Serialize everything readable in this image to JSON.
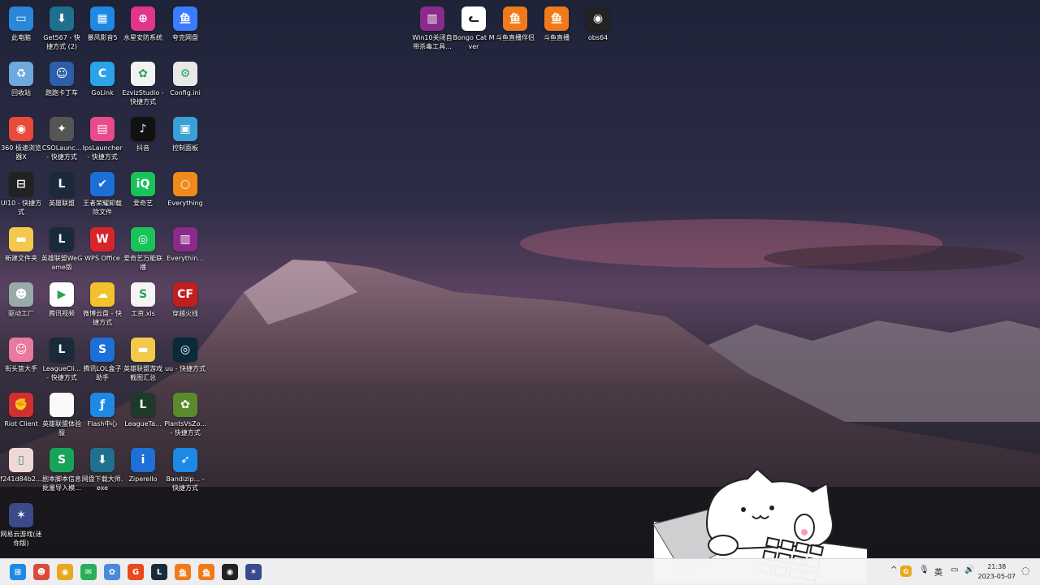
{
  "desktop": {
    "icons": [
      {
        "label": "此电脑",
        "icon": "computer-icon",
        "color": "#2b87d8",
        "glyph": "▭"
      },
      {
        "label": "Get567 - 快捷方式 (2)",
        "icon": "download-icon",
        "color": "#1f6f8f",
        "glyph": "⬇"
      },
      {
        "label": "暴风影音5",
        "icon": "grid-app-icon",
        "color": "#1e88e5",
        "glyph": "▦"
      },
      {
        "label": "水星安防系统",
        "icon": "target-icon",
        "color": "#e0358a",
        "glyph": "⊕"
      },
      {
        "label": "夸克网盘",
        "icon": "cloud-icon",
        "color": "#3a7bff",
        "glyph": "鱼"
      },
      {
        "label": "回收站",
        "icon": "recycle-bin-icon",
        "color": "#6fa8dc",
        "glyph": "♻"
      },
      {
        "label": "跑跑卡丁车",
        "icon": "kart-game-icon",
        "color": "#2d5ea8",
        "glyph": "☺"
      },
      {
        "label": "GoLink",
        "icon": "golink-icon",
        "color": "#2aa3e8",
        "glyph": "C"
      },
      {
        "label": "EzvizStudio - 快捷方式",
        "icon": "ezviz-icon",
        "color": "#f2f2f2",
        "glyph": "✿"
      },
      {
        "label": "Config.ini",
        "icon": "ini-file-icon",
        "color": "#e8e8e8",
        "glyph": "⚙"
      },
      {
        "label": "360 极速浏览器X",
        "icon": "browser-360-icon",
        "color": "#e84a3c",
        "glyph": "◉"
      },
      {
        "label": "CSOLaunc... - 快捷方式",
        "icon": "cso-soldier-icon",
        "color": "#555",
        "glyph": "✦"
      },
      {
        "label": "IpsLauncher - 快捷方式",
        "icon": "ips-launcher-icon",
        "color": "#e84a8a",
        "glyph": "▤"
      },
      {
        "label": "抖音",
        "icon": "tiktok-icon",
        "color": "#111",
        "glyph": "♪"
      },
      {
        "label": "控制面板",
        "icon": "control-panel-icon",
        "color": "#3aa0d8",
        "glyph": "▣"
      },
      {
        "label": "UI10 - 快捷方式",
        "icon": "ui10-icon",
        "color": "#222",
        "glyph": "⊟"
      },
      {
        "label": "英雄联盟",
        "icon": "league-icon",
        "color": "#1a2a3a",
        "glyph": "L"
      },
      {
        "label": "王者荣耀卸载除文件",
        "icon": "shield-check-icon",
        "color": "#1d6fd8",
        "glyph": "✔"
      },
      {
        "label": "爱奇艺",
        "icon": "iqiyi-icon",
        "color": "#19c35a",
        "glyph": "iQ"
      },
      {
        "label": "Everything",
        "icon": "search-icon",
        "color": "#f08a1c",
        "glyph": "○"
      },
      {
        "label": "新建文件夹",
        "icon": "folder-icon",
        "color": "#f2c94c",
        "glyph": "▬"
      },
      {
        "label": "英雄联盟WeGame版",
        "icon": "league-icon",
        "color": "#1a2a3a",
        "glyph": "L"
      },
      {
        "label": "WPS Office",
        "icon": "wps-icon",
        "color": "#d8252a",
        "glyph": "W"
      },
      {
        "label": "爱奇艺万能联播",
        "icon": "iqiyi-player-icon",
        "color": "#19c35a",
        "glyph": "◎"
      },
      {
        "label": "Everythin...",
        "icon": "winrar-icon",
        "color": "#8a2a8a",
        "glyph": "▥"
      },
      {
        "label": "驱动工厂",
        "icon": "robot-icon",
        "color": "#9aa",
        "glyph": "☻"
      },
      {
        "label": "腾讯视频",
        "icon": "tencent-video-icon",
        "color": "#ffffff",
        "glyph": "▶"
      },
      {
        "label": "微博云盘 - 快捷方式",
        "icon": "cloud-drive-icon",
        "color": "#f2c22c",
        "glyph": "☁"
      },
      {
        "label": "工资.xls",
        "icon": "spreadsheet-icon",
        "color": "#f4f4f4",
        "glyph": "S"
      },
      {
        "label": "穿越火线",
        "icon": "crossfire-icon",
        "color": "#c21e1e",
        "glyph": "CF"
      },
      {
        "label": "街头篮大手",
        "icon": "anime-game-icon",
        "color": "#e87aa0",
        "glyph": "☺"
      },
      {
        "label": "LeagueCli... - 快捷方式",
        "icon": "league-icon",
        "color": "#1a2a3a",
        "glyph": "L"
      },
      {
        "label": "腾讯LOL盒子助手",
        "icon": "s-logo-icon",
        "color": "#1d6fd8",
        "glyph": "S"
      },
      {
        "label": "英雄联盟游戏截图汇总",
        "icon": "folder-icon",
        "color": "#f2c94c",
        "glyph": "▬"
      },
      {
        "label": "uu - 快捷方式",
        "icon": "uu-icon",
        "color": "#0a2a3a",
        "glyph": "◎"
      },
      {
        "label": "Riot Client",
        "icon": "riot-fist-icon",
        "color": "#d32f2f",
        "glyph": "✊"
      },
      {
        "label": "英雄联盟体验服",
        "icon": "blank-file-icon",
        "color": "#fafafa",
        "glyph": ""
      },
      {
        "label": "Flash中心",
        "icon": "flash-icon",
        "color": "#1e88e5",
        "glyph": "ƒ"
      },
      {
        "label": "LeagueTa...",
        "icon": "league-icon",
        "color": "#1d3a2a",
        "glyph": "L"
      },
      {
        "label": "PlantsVsZo... - 快捷方式",
        "icon": "plants-icon",
        "color": "#5a8a2a",
        "glyph": "✿"
      },
      {
        "label": "f241d84b2...",
        "icon": "image-file-icon",
        "color": "#f0d8d8",
        "glyph": "▯"
      },
      {
        "label": "剧本脚本信息批量导入模...",
        "icon": "spreadsheet-icon",
        "color": "#19a35a",
        "glyph": "S"
      },
      {
        "label": "网盘下载大师.exe",
        "icon": "download-icon",
        "color": "#1f6f8f",
        "glyph": "⬇"
      },
      {
        "label": "Ziperello",
        "icon": "ziperello-icon",
        "color": "#1e6fd8",
        "glyph": "i"
      },
      {
        "label": "Bandizip... - 快捷方式",
        "icon": "bandizip-icon",
        "color": "#1e88e5",
        "glyph": "➶"
      },
      {
        "label": "网易云游戏(迷你版)",
        "icon": "cloud-game-icon",
        "color": "#3a4a8a",
        "glyph": "✶"
      }
    ],
    "top_icons": [
      {
        "label": "Win10关闭自带杀毒工具...",
        "icon": "winrar-icon",
        "color": "#8a2a8a",
        "glyph": "▥"
      },
      {
        "label": "Bongo Cat Mver",
        "icon": "bongo-cat-icon",
        "color": "#ffffff",
        "glyph": "ᓚ"
      },
      {
        "label": "斗鱼直播伴侣",
        "icon": "douyu-icon",
        "color": "#f07a1a",
        "glyph": "鱼"
      },
      {
        "label": "斗鱼直播",
        "icon": "douyu-icon",
        "color": "#f07a1a",
        "glyph": "鱼"
      },
      {
        "label": "obs64",
        "icon": "obs-icon",
        "color": "#222",
        "glyph": "◉"
      }
    ]
  },
  "taskbar": {
    "apps": [
      {
        "name": "start-button",
        "icon": "windows-logo-icon",
        "color": "#1e88e5",
        "glyph": "⊞"
      },
      {
        "name": "taskbar-game-app",
        "icon": "game-character-icon",
        "color": "#d84a3a",
        "glyph": "☻"
      },
      {
        "name": "taskbar-chrome",
        "icon": "chrome-icon",
        "color": "#e8a71c",
        "glyph": "◉"
      },
      {
        "name": "taskbar-wechat",
        "icon": "wechat-icon",
        "color": "#2aae5a",
        "glyph": "✉"
      },
      {
        "name": "taskbar-ezviz",
        "icon": "ezviz-icon",
        "color": "#4a8ad8",
        "glyph": "✿"
      },
      {
        "name": "taskbar-garena",
        "icon": "g-logo-icon",
        "color": "#e84a1c",
        "glyph": "G"
      },
      {
        "name": "taskbar-league",
        "icon": "league-icon",
        "color": "#1a2a3a",
        "glyph": "L"
      },
      {
        "name": "taskbar-douyu-companion",
        "icon": "douyu-icon",
        "color": "#f07a1a",
        "glyph": "鱼"
      },
      {
        "name": "taskbar-douyu",
        "icon": "douyu-icon",
        "color": "#f07a1a",
        "glyph": "鱼"
      },
      {
        "name": "taskbar-obs",
        "icon": "obs-icon",
        "color": "#222",
        "glyph": "◉"
      },
      {
        "name": "taskbar-cloud-game",
        "icon": "cloud-game-icon",
        "color": "#3a4a8a",
        "glyph": "✶"
      }
    ],
    "tray": {
      "chevron": "^",
      "lang": "英",
      "time": "21:38",
      "date": "2023-05-07"
    }
  }
}
